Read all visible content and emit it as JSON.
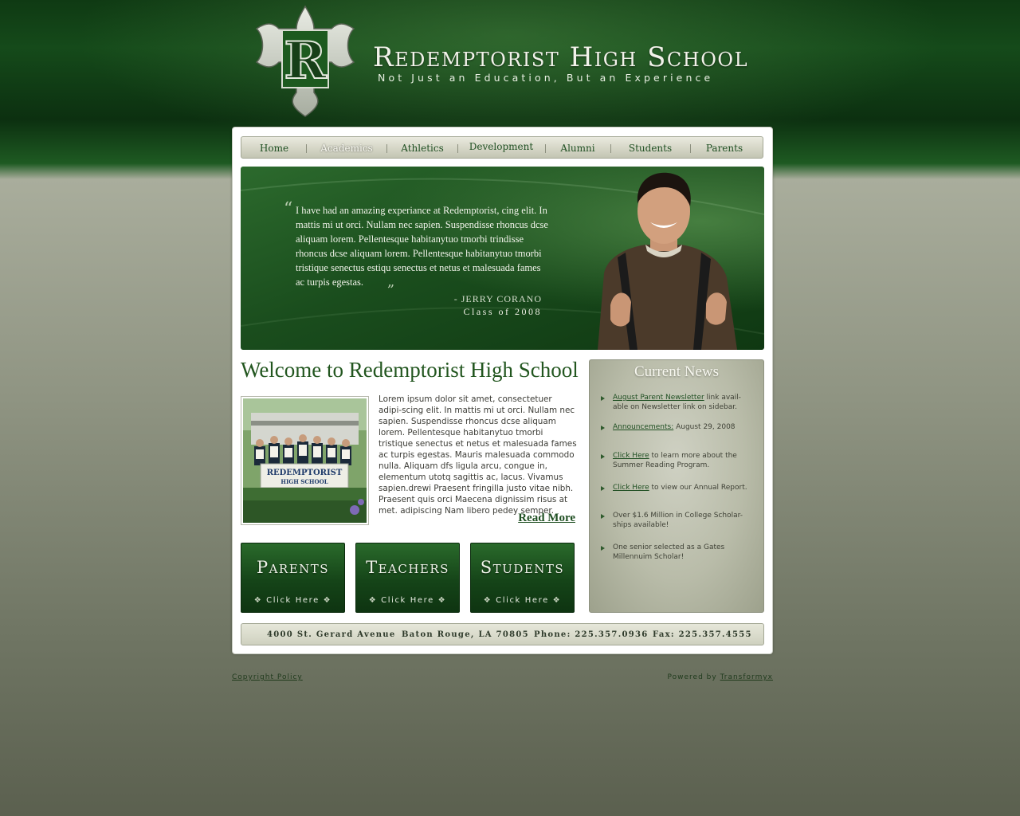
{
  "header": {
    "school_name": "Redemptorist High School",
    "tagline": "Not Just an Education, But an Experience",
    "logo_letter": "R"
  },
  "nav": {
    "items": [
      {
        "label": "Home",
        "active": false
      },
      {
        "label": "Academics",
        "active": true
      },
      {
        "label": "Athletics",
        "active": false
      },
      {
        "label": "Development",
        "active": false
      },
      {
        "label": "Alumni",
        "active": false
      },
      {
        "label": "Students",
        "active": false
      },
      {
        "label": "Parents",
        "active": false
      }
    ]
  },
  "hero": {
    "quote": "I have had an amazing experiance at Redemptorist, cing elit. In mattis mi ut orci. Nullam nec sapien. Suspendisse rhoncus dcse aliquam lorem. Pellentesque habitanytuo tmorbi trindisse rhoncus dcse aliquam lorem. Pellentesque habitanytuo tmorbi tristique senectus estiqu senectus et netus et malesuada fames ac turpis egestas.",
    "author": "JERRY CORANO",
    "author_dash": "-",
    "class": "Class of 2008"
  },
  "welcome": {
    "title": "Welcome to Redemptorist High School",
    "body": "Lorem ipsum dolor sit amet, consectetuer adipi-scing elit. In mattis mi ut orci. Nullam nec sapien. Suspendisse rhoncus dcse aliquam lorem. Pellentesque habitanytuo tmorbi tristique senectus et netus et malesuada fames ac turpis egestas. Mauris malesuada commodo nulla. Aliquam dfs ligula arcu, congue in, elementum utotq sagittis ac, lacus. Vivamus sapien.drewi Praesent fringilla justo vitae nibh. Praesent quis orci Maecena dignissim risus at met. adipiscing Nam libero pedey semper.",
    "read_more": "Read More",
    "photo_sign_line1": "REDEMPTORIST",
    "photo_sign_line2": "HIGH SCHOOL"
  },
  "audience_buttons": [
    {
      "title": "Parents",
      "click": "Click Here"
    },
    {
      "title": "Teachers",
      "click": "Click Here"
    },
    {
      "title": "Students",
      "click": "Click Here"
    }
  ],
  "news": {
    "title": "Current News",
    "items": [
      {
        "link": "August Parent Newsletter",
        "text": " link avail-able on Newsletter link on sidebar."
      },
      {
        "link": "Announcements:",
        "text": " August 29, 2008"
      },
      {
        "link": "Click Here",
        "text": " to learn more about the Summer Reading Program."
      },
      {
        "link": "Click Here",
        "text": " to view our Annual Report."
      },
      {
        "link": "",
        "text": "Over $1.6 Million in College Scholar-ships available!"
      },
      {
        "link": "",
        "text": "One senior selected as a Gates Millennuim Scholar!"
      }
    ]
  },
  "footer": {
    "address": "4000 St. Gerard Avenue",
    "city": "Baton Rouge, LA 70805",
    "phone": "Phone: 225.357.0936",
    "fax": "Fax: 225.357.4555"
  },
  "bottom": {
    "copyright": "Copyright Policy",
    "powered_prefix": "Powered by ",
    "powered_link": "Transformyx"
  },
  "colors": {
    "brand_green": "#1f4f22",
    "header_dark": "#0f3a13",
    "news_panel": "#b9bca9"
  }
}
